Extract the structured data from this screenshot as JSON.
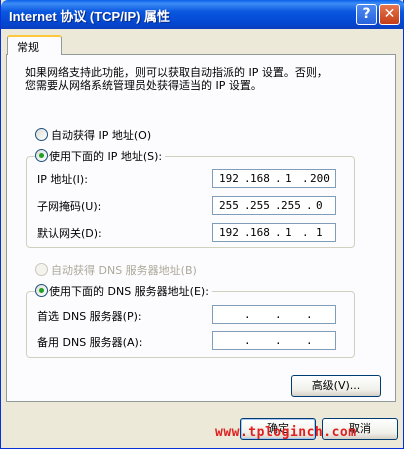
{
  "window": {
    "title": "Internet 协议 (TCP/IP) 属性",
    "help_label": "?",
    "close_label": "✕"
  },
  "tabs": [
    {
      "label": "常规"
    }
  ],
  "description": {
    "line1": "如果网络支持此功能，则可以获取自动指派的 IP 设置。否则，",
    "line2": "您需要从网络系统管理员处获得适当的 IP 设置。"
  },
  "ip": {
    "auto_label": "自动获得 IP 地址(O)",
    "manual_label": "使用下面的 IP 地址(S):",
    "selected": "manual",
    "fields": [
      {
        "label": "IP 地址(I):",
        "octets": [
          "192",
          "168",
          "1",
          "200"
        ]
      },
      {
        "label": "子网掩码(U):",
        "octets": [
          "255",
          "255",
          "255",
          "0"
        ]
      },
      {
        "label": "默认网关(D):",
        "octets": [
          "192",
          "168",
          "1",
          "1"
        ]
      }
    ]
  },
  "dns": {
    "auto_label": "自动获得 DNS 服务器地址(B)",
    "manual_label": "使用下面的 DNS 服务器地址(E):",
    "selected": "manual",
    "fields": [
      {
        "label": "首选 DNS 服务器(P):",
        "octets": [
          "",
          "",
          "",
          ""
        ]
      },
      {
        "label": "备用 DNS 服务器(A):",
        "octets": [
          "",
          "",
          "",
          ""
        ]
      }
    ]
  },
  "buttons": {
    "advanced": "高级(V)...",
    "ok": "确定",
    "cancel": "取消"
  },
  "watermark": "www.tploginch.com"
}
